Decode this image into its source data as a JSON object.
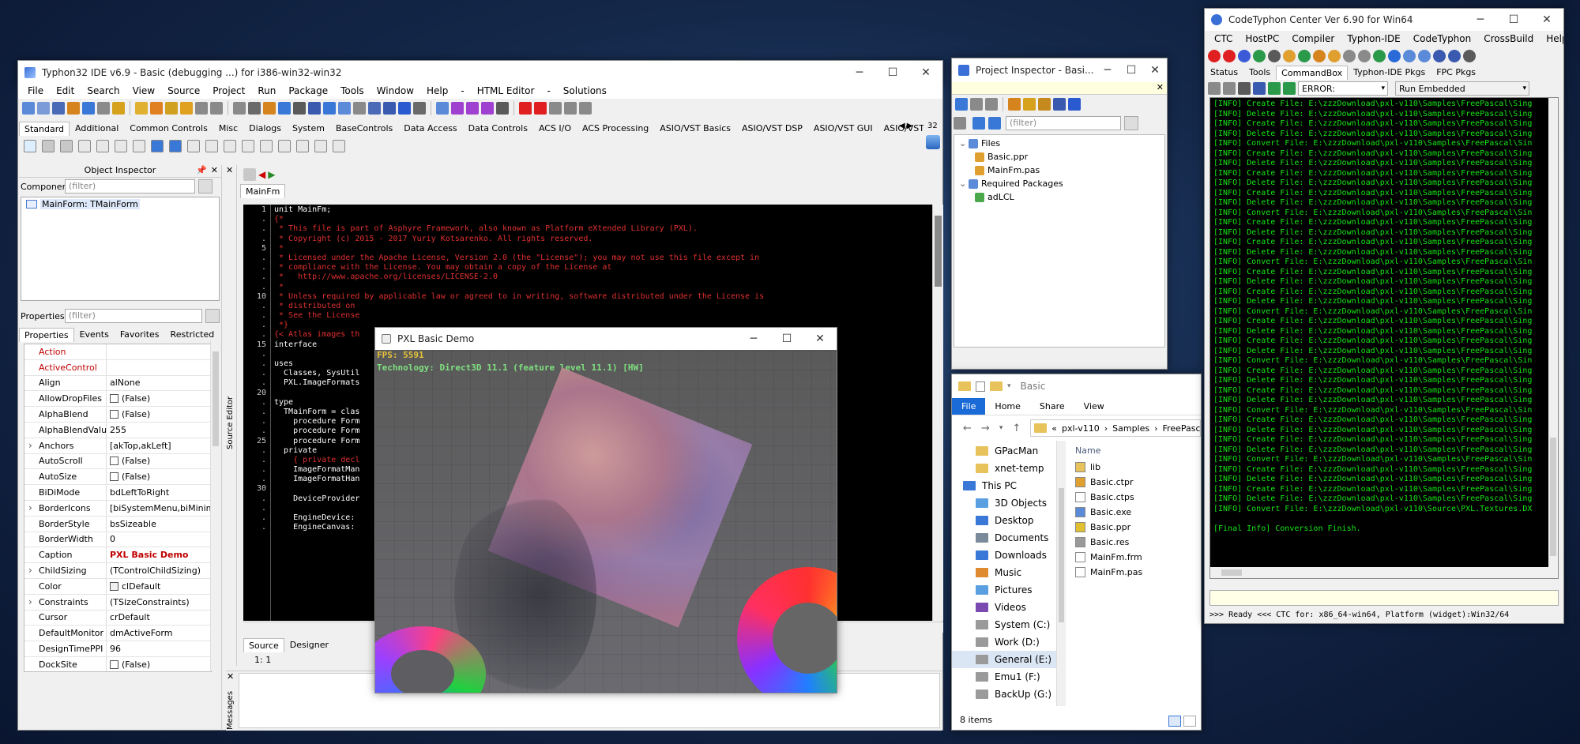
{
  "ide": {
    "title": "Typhon32 IDE v6.9 - Basic (debugging ...) for i386-win32-win32",
    "menu": [
      "File",
      "Edit",
      "Search",
      "View",
      "Source",
      "Project",
      "Run",
      "Package",
      "Tools",
      "Window",
      "Help",
      "-",
      "HTML Editor",
      "-",
      "Solutions"
    ],
    "palette_tabs": [
      "Standard",
      "Additional",
      "Common Controls",
      "Misc",
      "Dialogs",
      "System",
      "BaseControls",
      "Data Access",
      "Data Controls",
      "ACS I/O",
      "ACS Processing",
      "ASIO/VST Basics",
      "ASIO/VST DSP",
      "ASIO/VST GUI",
      "ASIO/VST GUI Stitched",
      "ASIO/"
    ],
    "palette_count": "32"
  },
  "object_inspector": {
    "title": "Object Inspector",
    "components_label": "Components",
    "filter_placeholder": "(filter)",
    "tree_item": "MainForm: TMainForm",
    "properties_label": "Properties",
    "tabs": [
      "Properties",
      "Events",
      "Favorites",
      "Restricted"
    ],
    "rows": [
      {
        "name": "Action",
        "value": "",
        "red": true
      },
      {
        "name": "ActiveControl",
        "value": "",
        "red": true
      },
      {
        "name": "Align",
        "value": "alNone"
      },
      {
        "name": "AllowDropFiles",
        "value": "(False)",
        "check": true
      },
      {
        "name": "AlphaBlend",
        "value": "(False)",
        "check": true
      },
      {
        "name": "AlphaBlendValu",
        "value": "255"
      },
      {
        "name": "Anchors",
        "value": "[akTop,akLeft]",
        "expand": true
      },
      {
        "name": "AutoScroll",
        "value": "(False)",
        "check": true
      },
      {
        "name": "AutoSize",
        "value": "(False)",
        "check": true
      },
      {
        "name": "BiDiMode",
        "value": "bdLeftToRight"
      },
      {
        "name": "BorderIcons",
        "value": "[biSystemMenu,biMinimize",
        "expand": true
      },
      {
        "name": "BorderStyle",
        "value": "bsSizeable"
      },
      {
        "name": "BorderWidth",
        "value": "0"
      },
      {
        "name": "Caption",
        "value": "PXL Basic Demo",
        "bold": true
      },
      {
        "name": "ChildSizing",
        "value": "(TControlChildSizing)",
        "expand": true
      },
      {
        "name": "Color",
        "value": "clDefault",
        "swatch": true
      },
      {
        "name": "Constraints",
        "value": "(TSizeConstraints)",
        "expand": true
      },
      {
        "name": "Cursor",
        "value": "crDefault"
      },
      {
        "name": "DefaultMonitor",
        "value": "dmActiveForm"
      },
      {
        "name": "DesignTimePPI",
        "value": "96"
      },
      {
        "name": "DockSite",
        "value": "(False)",
        "check": true
      }
    ]
  },
  "editor": {
    "tab": "MainFm",
    "side_label": "Source Editor",
    "bottom_tabs": [
      "Source",
      "Designer"
    ],
    "status_pos": "1:  1",
    "messages_label": "Messages",
    "gutter": [
      "1",
      ".",
      ".",
      ".",
      "5",
      ".",
      ".",
      ".",
      ".",
      "10",
      ".",
      ".",
      ".",
      ".",
      "15",
      ".",
      ".",
      ".",
      ".",
      "20",
      ".",
      ".",
      ".",
      ".",
      "25",
      ".",
      ".",
      ".",
      ".",
      "30",
      ".",
      ".",
      ".",
      "."
    ],
    "lines": [
      {
        "t": "unit MainFm;",
        "c": "#fff"
      },
      {
        "t": "{*",
        "c": "#e03030"
      },
      {
        "t": " * This file is part of Asphyre Framework, also known as Platform eXtended Library (PXL).",
        "c": "#e03030"
      },
      {
        "t": " * Copyright (c) 2015 - 2017 Yuriy Kotsarenko. All rights reserved.",
        "c": "#e03030"
      },
      {
        "t": " *",
        "c": "#e03030"
      },
      {
        "t": " * Licensed under the Apache License, Version 2.0 (the \"License\"); you may not use this file except in",
        "c": "#e03030"
      },
      {
        "t": " * compliance with the License. You may obtain a copy of the License at",
        "c": "#e03030"
      },
      {
        "t": " *   http://www.apache.org/licenses/LICENSE-2.0",
        "c": "#e03030"
      },
      {
        "t": " *",
        "c": "#e03030"
      },
      {
        "t": " * Unless required by applicable law or agreed to in writing, software distributed under the License is",
        "c": "#e03030"
      },
      {
        "t": " * distributed on",
        "c": "#e03030"
      },
      {
        "t": " * See the License",
        "c": "#e03030"
      },
      {
        "t": " *}",
        "c": "#e03030"
      },
      {
        "t": "{< Atlas images th                                                                           anvas. }",
        "c": "#e03030"
      },
      {
        "t": "interface",
        "c": "#fff"
      },
      {
        "t": "",
        "c": "#fff"
      },
      {
        "t": "uses",
        "c": "#fff"
      },
      {
        "t": "  Classes, SysUtil                                                                              ices,",
        "c": "#fff"
      },
      {
        "t": "  PXL.ImageFormats",
        "c": "#fff"
      },
      {
        "t": "",
        "c": "#fff"
      },
      {
        "t": "type",
        "c": "#fff"
      },
      {
        "t": "  TMainForm = clas",
        "c": "#fff"
      },
      {
        "t": "    procedure Form",
        "c": "#fff"
      },
      {
        "t": "    procedure Form",
        "c": "#fff"
      },
      {
        "t": "    procedure Form",
        "c": "#fff"
      },
      {
        "t": "  private",
        "c": "#fff"
      },
      {
        "t": "    { private decl",
        "c": "#e03030"
      },
      {
        "t": "    ImageFormatMan",
        "c": "#fff"
      },
      {
        "t": "    ImageFormatHan",
        "c": "#fff"
      },
      {
        "t": "",
        "c": "#fff"
      },
      {
        "t": "    DeviceProvider",
        "c": "#fff"
      },
      {
        "t": "",
        "c": "#fff"
      },
      {
        "t": "    EngineDevice: ",
        "c": "#fff"
      },
      {
        "t": "    EngineCanvas: ",
        "c": "#fff"
      }
    ]
  },
  "demo": {
    "title": "PXL Basic Demo",
    "fps": "FPS: 5591",
    "tech": "Technology: Direct3D 11.1 (feature level 11.1) [HW]"
  },
  "project_inspector": {
    "title": "Project Inspector - Basi...",
    "filter": "(filter)",
    "tree": [
      {
        "label": "Files",
        "level": 0
      },
      {
        "label": "Basic.ppr",
        "level": 1
      },
      {
        "label": "MainFm.pas",
        "level": 1
      },
      {
        "label": "Required Packages",
        "level": 0
      },
      {
        "label": "adLCL",
        "level": 1
      }
    ]
  },
  "explorer": {
    "title": "Basic",
    "ribbon": [
      "File",
      "Home",
      "Share",
      "View"
    ],
    "path": [
      "pxl-v110",
      "Samples",
      "FreePascal"
    ],
    "nav": [
      {
        "label": "GPacMan",
        "kind": "folder"
      },
      {
        "label": "xnet-temp",
        "kind": "folder"
      },
      {
        "label": "This PC",
        "kind": "pc"
      },
      {
        "label": "3D Objects",
        "kind": "obj"
      },
      {
        "label": "Desktop",
        "kind": "desk"
      },
      {
        "label": "Documents",
        "kind": "doc"
      },
      {
        "label": "Downloads",
        "kind": "down"
      },
      {
        "label": "Music",
        "kind": "music"
      },
      {
        "label": "Pictures",
        "kind": "pic"
      },
      {
        "label": "Videos",
        "kind": "vid"
      },
      {
        "label": "System (C:)",
        "kind": "drive"
      },
      {
        "label": "Work (D:)",
        "kind": "drive"
      },
      {
        "label": "General (E:)",
        "kind": "drive"
      },
      {
        "label": "Emu1 (F:)",
        "kind": "drive"
      },
      {
        "label": "BackUp (G:)",
        "kind": "drive"
      }
    ],
    "column": "Name",
    "files": [
      {
        "label": "lib",
        "kind": "folder"
      },
      {
        "label": "Basic.ctpr",
        "kind": "ctpr"
      },
      {
        "label": "Basic.ctps",
        "kind": "file"
      },
      {
        "label": "Basic.exe",
        "kind": "exe"
      },
      {
        "label": "Basic.ppr",
        "kind": "ppr"
      },
      {
        "label": "Basic.res",
        "kind": "res"
      },
      {
        "label": "MainFm.frm",
        "kind": "frm"
      },
      {
        "label": "MainFm.pas",
        "kind": "pas"
      }
    ],
    "status": "8 items"
  },
  "ctc": {
    "title": "CodeTyphon Center Ver 6.90 for Win64",
    "menu": [
      "CTC",
      "HostPC",
      "Compiler",
      "Typhon-IDE",
      "CodeTyphon",
      "CrossBuild",
      "Help"
    ],
    "tabs": [
      "Status",
      "Tools",
      "CommandBox",
      "Typhon-IDE Pkgs",
      "FPC Pkgs"
    ],
    "level": "ERROR:",
    "run_mode": "Run Embedded",
    "log": [
      "[INFO] Create File: E:\\zzzDownload\\pxl-v110\\Samples\\FreePascal\\Sing",
      "[INFO] Delete File: E:\\zzzDownload\\pxl-v110\\Samples\\FreePascal\\Sing",
      "[INFO] Create File: E:\\zzzDownload\\pxl-v110\\Samples\\FreePascal\\Sing",
      "[INFO] Delete File: E:\\zzzDownload\\pxl-v110\\Samples\\FreePascal\\Sing",
      "[INFO] Convert File: E:\\zzzDownload\\pxl-v110\\Samples\\FreePascal\\Sin",
      "[INFO] Create File: E:\\zzzDownload\\pxl-v110\\Samples\\FreePascal\\Sing",
      "[INFO] Delete File: E:\\zzzDownload\\pxl-v110\\Samples\\FreePascal\\Sing",
      "[INFO] Create File: E:\\zzzDownload\\pxl-v110\\Samples\\FreePascal\\Sing",
      "[INFO] Delete File: E:\\zzzDownload\\pxl-v110\\Samples\\FreePascal\\Sing",
      "[INFO] Create File: E:\\zzzDownload\\pxl-v110\\Samples\\FreePascal\\Sing",
      "[INFO] Delete File: E:\\zzzDownload\\pxl-v110\\Samples\\FreePascal\\Sing",
      "[INFO] Convert File: E:\\zzzDownload\\pxl-v110\\Samples\\FreePascal\\Sin",
      "[INFO] Create File: E:\\zzzDownload\\pxl-v110\\Samples\\FreePascal\\Sing",
      "[INFO] Delete File: E:\\zzzDownload\\pxl-v110\\Samples\\FreePascal\\Sing",
      "[INFO] Create File: E:\\zzzDownload\\pxl-v110\\Samples\\FreePascal\\Sing",
      "[INFO] Delete File: E:\\zzzDownload\\pxl-v110\\Samples\\FreePascal\\Sing",
      "[INFO] Convert File: E:\\zzzDownload\\pxl-v110\\Samples\\FreePascal\\Sin",
      "[INFO] Create File: E:\\zzzDownload\\pxl-v110\\Samples\\FreePascal\\Sing",
      "[INFO] Delete File: E:\\zzzDownload\\pxl-v110\\Samples\\FreePascal\\Sing",
      "[INFO] Create File: E:\\zzzDownload\\pxl-v110\\Samples\\FreePascal\\Sing",
      "[INFO] Delete File: E:\\zzzDownload\\pxl-v110\\Samples\\FreePascal\\Sing",
      "[INFO] Convert File: E:\\zzzDownload\\pxl-v110\\Samples\\FreePascal\\Sin",
      "[INFO] Create File: E:\\zzzDownload\\pxl-v110\\Samples\\FreePascal\\Sing",
      "[INFO] Delete File: E:\\zzzDownload\\pxl-v110\\Samples\\FreePascal\\Sing",
      "[INFO] Create File: E:\\zzzDownload\\pxl-v110\\Samples\\FreePascal\\Sing",
      "[INFO] Delete File: E:\\zzzDownload\\pxl-v110\\Samples\\FreePascal\\Sing",
      "[INFO] Convert File: E:\\zzzDownload\\pxl-v110\\Samples\\FreePascal\\Sin",
      "[INFO] Create File: E:\\zzzDownload\\pxl-v110\\Samples\\FreePascal\\Sing",
      "[INFO] Delete File: E:\\zzzDownload\\pxl-v110\\Samples\\FreePascal\\Sing",
      "[INFO] Create File: E:\\zzzDownload\\pxl-v110\\Samples\\FreePascal\\Sing",
      "[INFO] Delete File: E:\\zzzDownload\\pxl-v110\\Samples\\FreePascal\\Sing",
      "[INFO] Convert File: E:\\zzzDownload\\pxl-v110\\Samples\\FreePascal\\Sin",
      "[INFO] Create File: E:\\zzzDownload\\pxl-v110\\Samples\\FreePascal\\Sing",
      "[INFO] Delete File: E:\\zzzDownload\\pxl-v110\\Samples\\FreePascal\\Sing",
      "[INFO] Create File: E:\\zzzDownload\\pxl-v110\\Samples\\FreePascal\\Sing",
      "[INFO] Delete File: E:\\zzzDownload\\pxl-v110\\Samples\\FreePascal\\Sing",
      "[INFO] Convert File: E:\\zzzDownload\\pxl-v110\\Samples\\FreePascal\\Sin",
      "[INFO] Create File: E:\\zzzDownload\\pxl-v110\\Samples\\FreePascal\\Sing",
      "[INFO] Delete File: E:\\zzzDownload\\pxl-v110\\Samples\\FreePascal\\Sing",
      "[INFO] Create File: E:\\zzzDownload\\pxl-v110\\Samples\\FreePascal\\Sing",
      "[INFO] Delete File: E:\\zzzDownload\\pxl-v110\\Samples\\FreePascal\\Sing",
      "[INFO] Convert File: E:\\zzzDownload\\pxl-v110\\Source\\PXL.Textures.DX",
      "",
      "[Final Info] Conversion Finish."
    ],
    "status": ">>> Ready <<<  CTC for: x86_64-win64, Platform (widget):Win32/64"
  }
}
